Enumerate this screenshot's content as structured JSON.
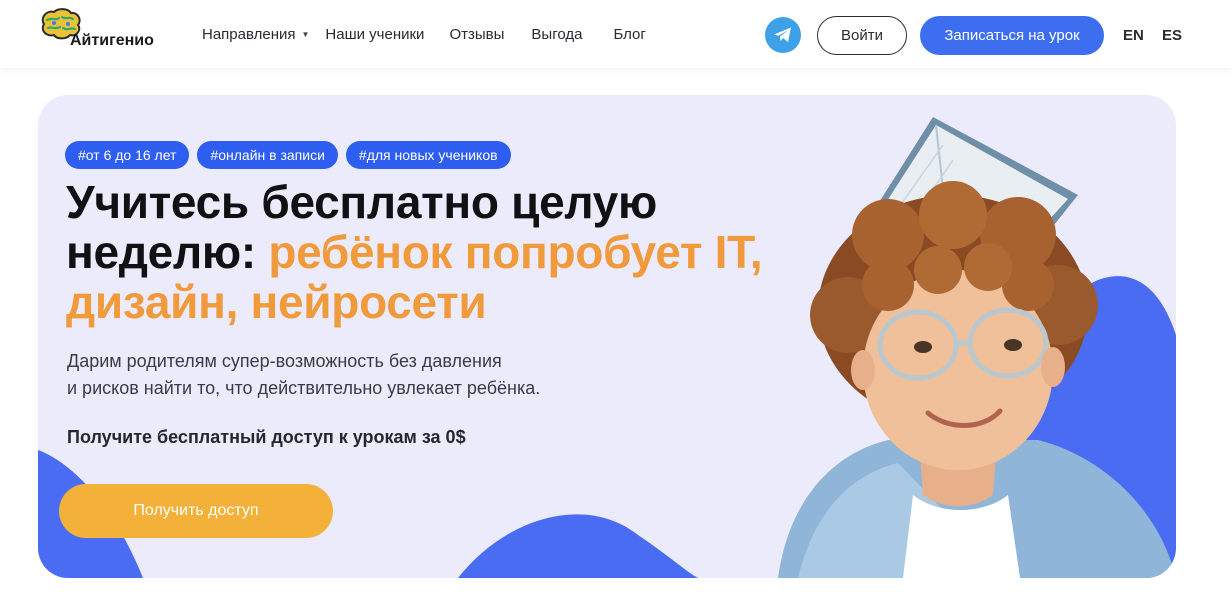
{
  "brand": {
    "name": "Айтигенио",
    "logo_icon": "brain-logo-icon"
  },
  "nav": {
    "items": [
      {
        "label": "Направления",
        "has_dropdown": true
      },
      {
        "label": "Наши ученики"
      },
      {
        "label": "Отзывы"
      },
      {
        "label": "Выгода"
      },
      {
        "label": "Блог"
      }
    ]
  },
  "header": {
    "telegram_icon": "telegram-icon",
    "login_label": "Войти",
    "signup_label": "Записаться на урок",
    "languages": [
      "EN",
      "ES"
    ]
  },
  "hero": {
    "tags": [
      "#от 6 до 16 лет",
      "#онлайн в записи",
      "#для новых учеников"
    ],
    "headline_dark_line1": "Учитесь бесплатно целую",
    "headline_dark_line2": "неделю:",
    "headline_accent_line2": "ребёнок попробует IT,",
    "headline_accent_line3": "дизайн, нейросети",
    "subtitle_line1": "Дарим родителям супер-возможность без давления",
    "subtitle_line2": "и рисков найти то, что действительно увлекает ребёнка.",
    "offer": "Получите бесплатный доступ к урокам за 0$",
    "cta_label": "Получить доступ",
    "image_subject": "child-with-book-on-head"
  },
  "colors": {
    "accent_blue": "#3d6ef0",
    "accent_orange": "#f19a3c",
    "cta_yellow": "#f3b139",
    "hero_bg": "#ecebfb"
  }
}
